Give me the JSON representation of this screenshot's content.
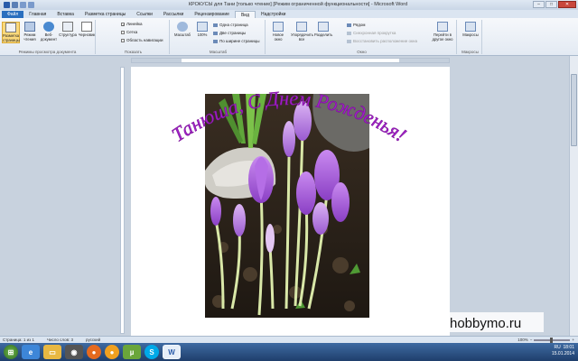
{
  "window": {
    "title": "КРОКУСЫ для Тани [только чтение] [Режим ограниченной функциональности] - Microsoft Word",
    "minimize": "–",
    "maximize": "□",
    "close": "✕"
  },
  "tabs": [
    {
      "label": "Файл"
    },
    {
      "label": "Главная"
    },
    {
      "label": "Вставка"
    },
    {
      "label": "Разметка страницы"
    },
    {
      "label": "Ссылки"
    },
    {
      "label": "Рассылки"
    },
    {
      "label": "Рецензирование"
    },
    {
      "label": "Вид"
    },
    {
      "label": "Надстройки"
    }
  ],
  "ribbon": {
    "view_modes": {
      "label": "Режимы просмотра документа",
      "buttons": [
        "Разметка страницы",
        "Режим чтения",
        "Веб-документ",
        "Структура",
        "Черновик"
      ]
    },
    "show": {
      "label": "Показать",
      "items": [
        {
          "text": "Линейка",
          "checked": true
        },
        {
          "text": "Сетка",
          "checked": false
        },
        {
          "text": "Область навигации",
          "checked": false
        }
      ]
    },
    "zoom": {
      "label": "Масштаб",
      "buttons": [
        "Масштаб",
        "100%"
      ],
      "rows": [
        "Одна страница",
        "Две страницы",
        "По ширине страницы"
      ]
    },
    "window": {
      "label": "Окно",
      "buttons": [
        "Новое окно",
        "Упорядочить все",
        "Разделить"
      ],
      "rows": [
        "Рядом",
        "Синхронная прокрутка",
        "Восстановить расположение окна"
      ],
      "switch": "Перейти в другое окно"
    },
    "macros": {
      "label": "Макросы",
      "button": "Макросы"
    }
  },
  "document": {
    "greeting": "Танюша, С Днем Рожденья!",
    "greeting_color": "#a020c8"
  },
  "status": {
    "page": "Страница: 1 из 1",
    "words": "Число слов: 3",
    "lang": "русский",
    "zoom": "100%"
  },
  "taskbar": {
    "lang": "RU",
    "time": "18:01",
    "date": "15.01.2014"
  },
  "watermark": "hobbymo.ru"
}
